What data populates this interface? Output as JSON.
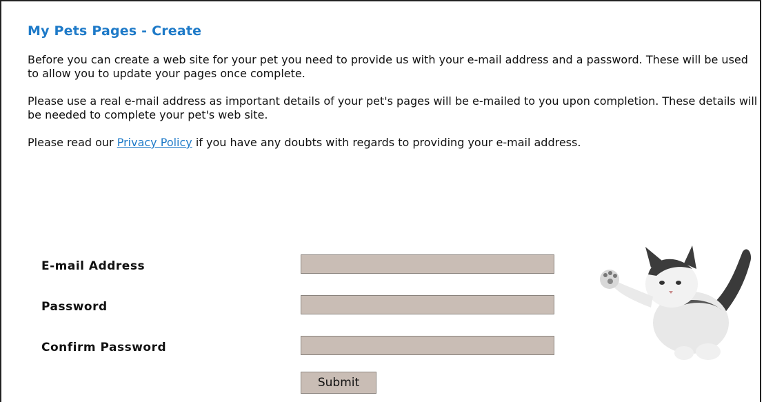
{
  "page": {
    "title": "My Pets Pages - Create",
    "para1": "Before you can create a web site for your pet you need to provide us with your e-mail address and a password. These will be used to allow you to update your pages once complete.",
    "para2": "Please use a real e-mail address as important details of your pet's pages will be e-mailed to you upon completion. These details will be needed to complete your pet's web site.",
    "para3_before": "Please read our ",
    "para3_link": "Privacy Policy",
    "para3_after": " if you have any doubts with regards to providing your e-mail address."
  },
  "form": {
    "email_label": "E-mail Address",
    "email_value": "",
    "password_label": "Password",
    "password_value": "",
    "confirm_label": "Confirm Password",
    "confirm_value": "",
    "submit_label": "Submit"
  },
  "colors": {
    "title": "#1e7ac8",
    "field_bg": "#c9bdb5",
    "link": "#1e7ac8"
  },
  "image": {
    "icon": "kitten-image"
  }
}
